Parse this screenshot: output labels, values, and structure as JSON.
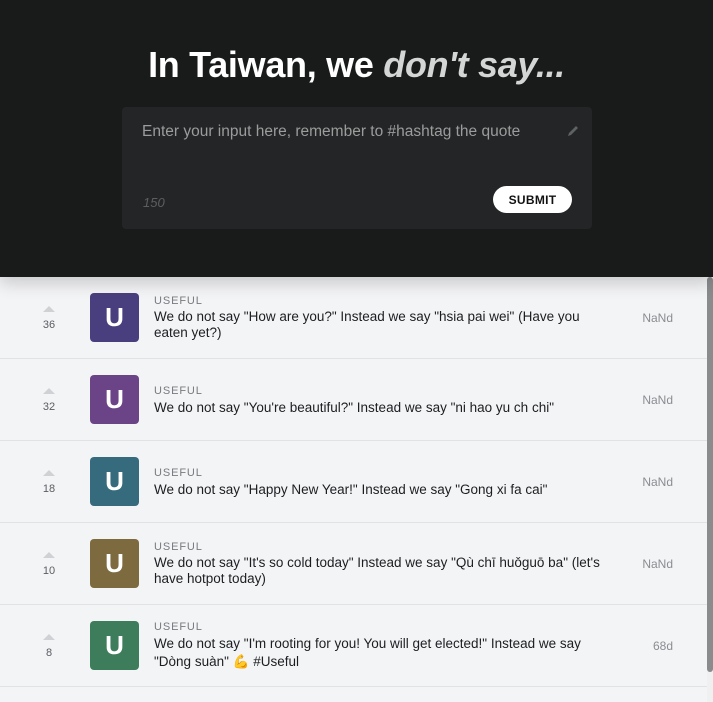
{
  "header": {
    "title_plain": "In Taiwan, we ",
    "title_emphasis": "don't say...",
    "input_placeholder": "Enter your input here, remember to #hashtag the quote",
    "char_count": "150",
    "submit_label": "SUBMIT"
  },
  "posts": [
    {
      "votes": "36",
      "avatar_letter": "U",
      "avatar_color": "#4a3f7e",
      "tag": "USEFUL",
      "text": "We do not say \"How are you?\" Instead we say \"hsia pai wei\" (Have you eaten yet?)",
      "age": "NaNd"
    },
    {
      "votes": "32",
      "avatar_letter": "U",
      "avatar_color": "#6b4487",
      "tag": "USEFUL",
      "text": "We do not say \"You're beautiful?\" Instead we say \"ni hao yu ch chi\"",
      "age": "NaNd"
    },
    {
      "votes": "18",
      "avatar_letter": "U",
      "avatar_color": "#356b7c",
      "tag": "USEFUL",
      "text": "We do not say \"Happy New Year!\" Instead we say \"Gong xi fa cai\"",
      "age": "NaNd"
    },
    {
      "votes": "10",
      "avatar_letter": "U",
      "avatar_color": "#7d6a3e",
      "tag": "USEFUL",
      "text": "We do not say \"It's so cold today\" Instead we say \"Qù chī huǒguō ba\" (let's have hotpot today)",
      "age": "NaNd"
    },
    {
      "votes": "8",
      "avatar_letter": "U",
      "avatar_color": "#3d7d5b",
      "tag": "USEFUL",
      "text": "We do not say \"I'm rooting for you! You will get elected!\" Instead we say \"Dòng suàn\" 💪 #Useful",
      "age": "68d"
    }
  ]
}
